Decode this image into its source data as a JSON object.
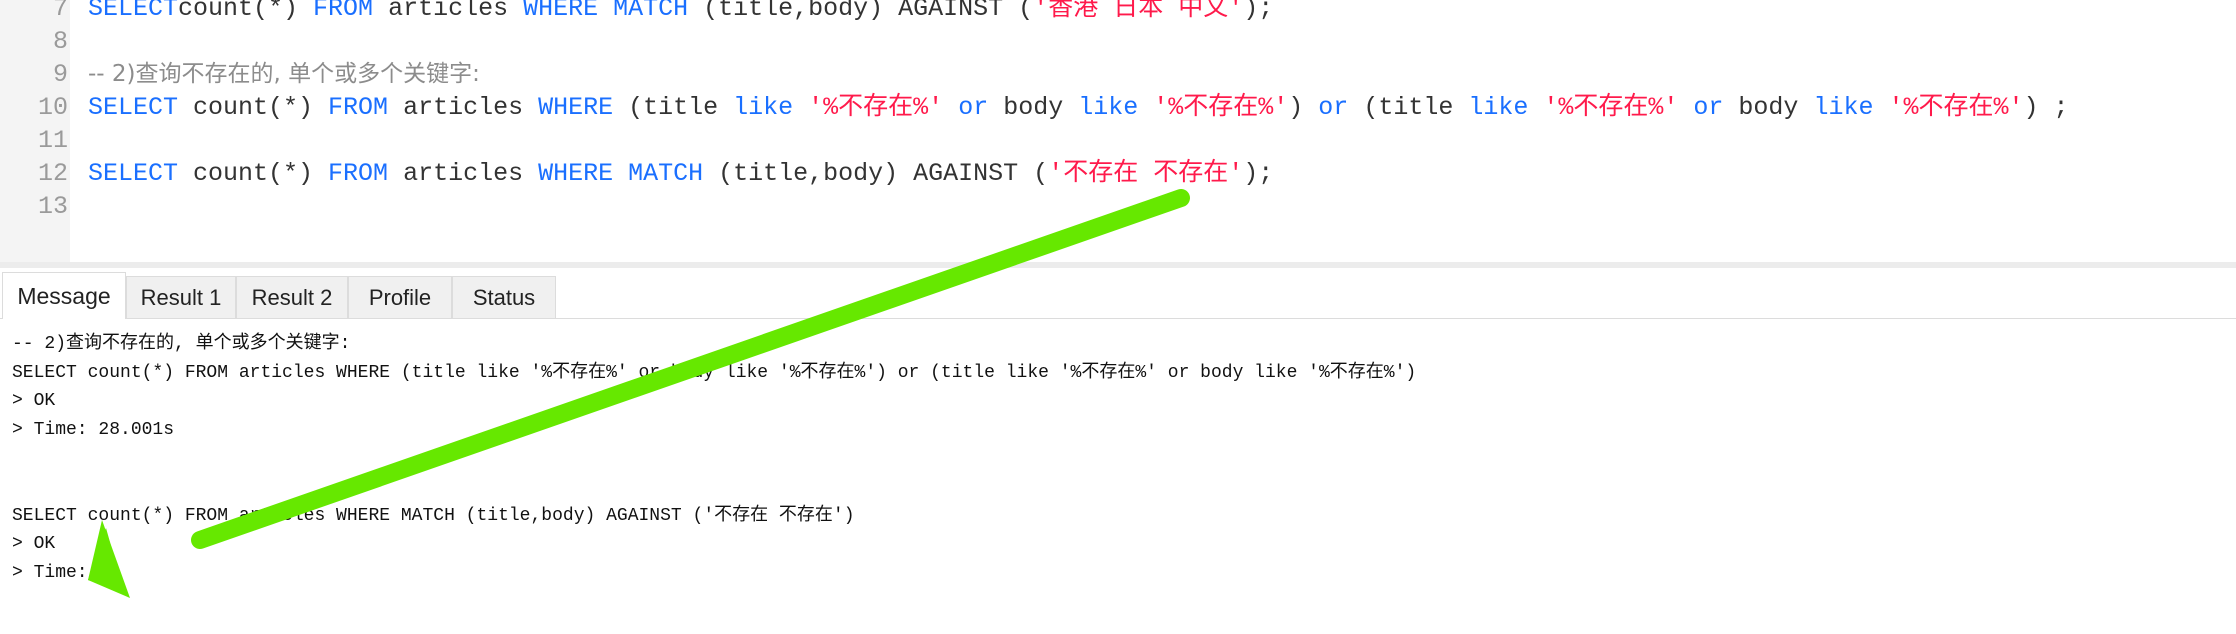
{
  "editor": {
    "lines": [
      {
        "num": "7",
        "parts": [
          [
            "kw",
            "SELECT"
          ],
          [
            "",
            "count(*) "
          ],
          [
            "kw",
            "FROM"
          ],
          [
            "",
            " articles "
          ],
          [
            "kw",
            "WHERE MATCH"
          ],
          [
            "",
            " (title,body) AGAINST ("
          ],
          [
            "str",
            "'香港 日本 中文'"
          ],
          [
            "",
            ");"
          ]
        ]
      },
      {
        "num": "8",
        "parts": []
      },
      {
        "num": "9",
        "parts": [
          [
            "cm",
            "-- 2)查询不存在的, 单个或多个关键字:"
          ]
        ]
      },
      {
        "num": "10",
        "parts": [
          [
            "kw",
            "SELECT"
          ],
          [
            "",
            " count(*) "
          ],
          [
            "kw",
            "FROM"
          ],
          [
            "",
            " articles "
          ],
          [
            "kw",
            "WHERE"
          ],
          [
            "",
            " (title "
          ],
          [
            "kw",
            "like"
          ],
          [
            "",
            " "
          ],
          [
            "str",
            "'%不存在%'"
          ],
          [
            "",
            " "
          ],
          [
            "kw",
            "or"
          ],
          [
            "",
            " body "
          ],
          [
            "kw",
            "like"
          ],
          [
            "",
            " "
          ],
          [
            "str",
            "'%不存在%'"
          ],
          [
            "",
            ") "
          ],
          [
            "kw",
            "or"
          ],
          [
            "",
            " (title "
          ],
          [
            "kw",
            "like"
          ],
          [
            "",
            " "
          ],
          [
            "str",
            "'%不存在%'"
          ],
          [
            "",
            " "
          ],
          [
            "kw",
            "or"
          ],
          [
            "",
            " body "
          ],
          [
            "kw",
            "like"
          ],
          [
            "",
            " "
          ],
          [
            "str",
            "'%不存在%'"
          ],
          [
            "",
            ") ;"
          ]
        ]
      },
      {
        "num": "11",
        "parts": []
      },
      {
        "num": "12",
        "parts": [
          [
            "kw",
            "SELECT"
          ],
          [
            "",
            " count(*) "
          ],
          [
            "kw",
            "FROM"
          ],
          [
            "",
            " articles "
          ],
          [
            "kw",
            "WHERE MATCH"
          ],
          [
            "",
            " (title,body) AGAINST ("
          ],
          [
            "str",
            "'不存在 不存在'"
          ],
          [
            "",
            ");"
          ]
        ]
      },
      {
        "num": "13",
        "parts": []
      }
    ]
  },
  "tabs": [
    {
      "label": "Message",
      "active": true
    },
    {
      "label": "Result 1"
    },
    {
      "label": "Result 2"
    },
    {
      "label": "Profile"
    },
    {
      "label": "Status"
    }
  ],
  "messages": [
    "-- 2)查询不存在的, 单个或多个关键字:",
    "SELECT count(*) FROM articles WHERE (title like '%不存在%' or body like '%不存在%') or (title like '%不存在%' or body like '%不存在%')",
    "> OK",
    "> Time: 28.001s",
    "",
    "",
    "SELECT count(*) FROM articles WHERE MATCH (title,body) AGAINST ('不存在 不存在')",
    "> OK",
    "> Time: 0s"
  ],
  "colors": {
    "keyword": "#1a6fff",
    "string": "#ff1a4b",
    "arrow": "#66e800"
  },
  "annotation": {
    "icon": "arrow-icon"
  }
}
